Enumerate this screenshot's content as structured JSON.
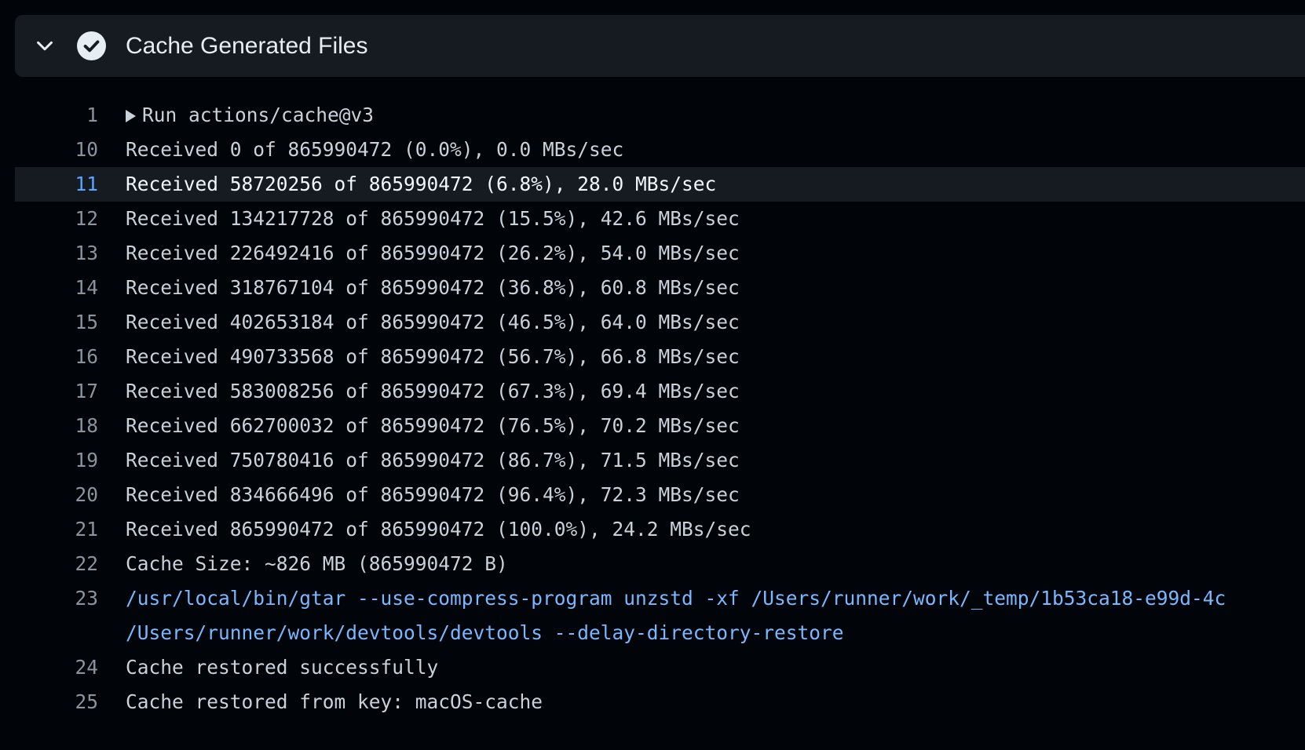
{
  "step": {
    "title": "Cache Generated Files",
    "status": "success",
    "expanded": true
  },
  "colors": {
    "background": "#010409",
    "header_background": "#161b22",
    "text": "#c9d1d9",
    "line_number": "#8b949e",
    "highlight_line_number": "#58a6ff",
    "command": "#79b8ff"
  },
  "log": {
    "run_line": {
      "num": "1",
      "text": "Run actions/cache@v3"
    },
    "lines": [
      {
        "num": "10",
        "text": "Received 0 of 865990472 (0.0%), 0.0 MBs/sec"
      },
      {
        "num": "11",
        "text": "Received 58720256 of 865990472 (6.8%), 28.0 MBs/sec"
      },
      {
        "num": "12",
        "text": "Received 134217728 of 865990472 (15.5%), 42.6 MBs/sec"
      },
      {
        "num": "13",
        "text": "Received 226492416 of 865990472 (26.2%), 54.0 MBs/sec"
      },
      {
        "num": "14",
        "text": "Received 318767104 of 865990472 (36.8%), 60.8 MBs/sec"
      },
      {
        "num": "15",
        "text": "Received 402653184 of 865990472 (46.5%), 64.0 MBs/sec"
      },
      {
        "num": "16",
        "text": "Received 490733568 of 865990472 (56.7%), 66.8 MBs/sec"
      },
      {
        "num": "17",
        "text": "Received 583008256 of 865990472 (67.3%), 69.4 MBs/sec"
      },
      {
        "num": "18",
        "text": "Received 662700032 of 865990472 (76.5%), 70.2 MBs/sec"
      },
      {
        "num": "19",
        "text": "Received 750780416 of 865990472 (86.7%), 71.5 MBs/sec"
      },
      {
        "num": "20",
        "text": "Received 834666496 of 865990472 (96.4%), 72.3 MBs/sec"
      },
      {
        "num": "21",
        "text": "Received 865990472 of 865990472 (100.0%), 24.2 MBs/sec"
      },
      {
        "num": "22",
        "text": "Cache Size: ~826 MB (865990472 B)"
      }
    ],
    "command_line": {
      "num": "23",
      "text": "/usr/local/bin/gtar --use-compress-program unzstd -xf /Users/runner/work/_temp/1b53ca18-e99d-4c",
      "continuation": "/Users/runner/work/devtools/devtools --delay-directory-restore"
    },
    "tail_lines": [
      {
        "num": "24",
        "text": "Cache restored successfully"
      },
      {
        "num": "25",
        "text": "Cache restored from key: macOS-cache"
      }
    ]
  }
}
